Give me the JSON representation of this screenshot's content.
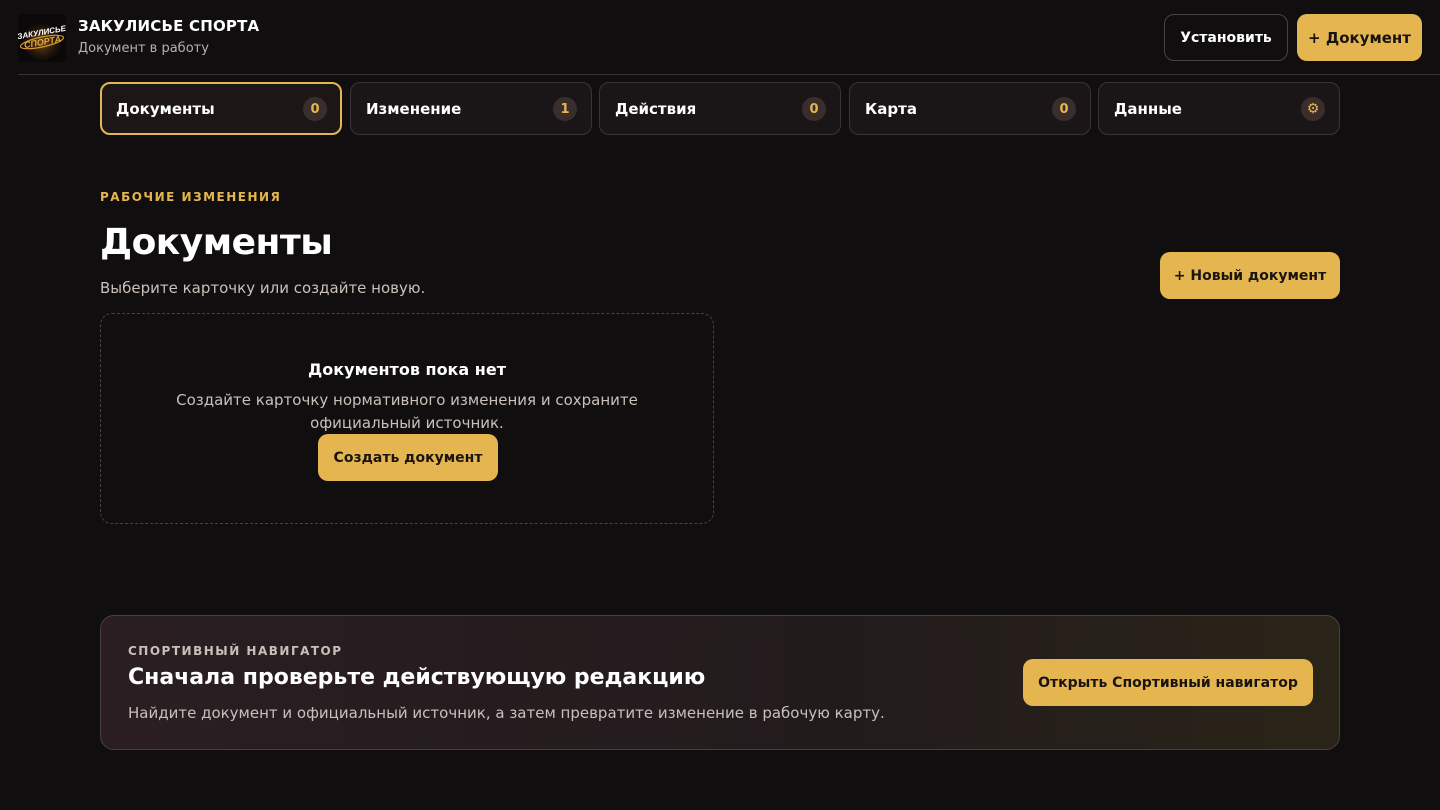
{
  "header": {
    "logo_text": "ЗАКУЛИСЬЕ СПОРТА",
    "title": "ЗАКУЛИСЬЕ СПОРТА",
    "subtitle": "Документ в работу",
    "install_label": "Установить",
    "add_document_label": "+ Документ"
  },
  "tabs": [
    {
      "label": "Документы",
      "badge": "0",
      "active": true
    },
    {
      "label": "Изменение",
      "badge": "1",
      "active": false
    },
    {
      "label": "Действия",
      "badge": "0",
      "active": false
    },
    {
      "label": "Карта",
      "badge": "0",
      "active": false
    },
    {
      "label": "Данные",
      "badge": "⚙",
      "active": false
    }
  ],
  "main": {
    "eyebrow": "РАБОЧИЕ ИЗМЕНЕНИЯ",
    "title": "Документы",
    "subtitle": "Выберите карточку или создайте новую.",
    "new_document_label": "+ Новый документ",
    "empty": {
      "title": "Документов пока нет",
      "text": "Создайте карточку нормативного изменения и сохраните официальный источник.",
      "create_label": "Создать документ"
    }
  },
  "navigator": {
    "eyebrow": "СПОРТИВНЫЙ НАВИГАТОР",
    "title": "Сначала проверьте действующую редакцию",
    "text": "Найдите документ и официальный источник, а затем превратите изменение в рабочую карту.",
    "open_label": "Открыть Спортивный навигатор"
  },
  "colors": {
    "background": "#110e0f",
    "accent": "#e5b64f",
    "border": "#3a3336"
  }
}
